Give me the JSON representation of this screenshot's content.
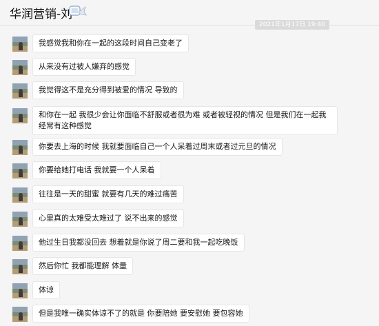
{
  "header": {
    "title": "华润营销-刘"
  },
  "time_badge": "2021年1月17日 19:40",
  "messages": [
    {
      "text": "我感觉我和你在一起的这段时间自己变老了"
    },
    {
      "text": "从来没有过被人嫌弃的感觉"
    },
    {
      "text": "我觉得这不是充分得到被爱的情况 导致的"
    },
    {
      "text": "和你在一起 我很少会让你面临不舒服或者很为难 或者被轻视的情况 但是我们在一起我经常有这种感觉"
    },
    {
      "text": "你要去上海的时候 我就要面临自己一个人呆着过周末或者过元旦的情况"
    },
    {
      "text": "你要给她打电话 我就要一个人呆着"
    },
    {
      "text": "往往是一天的甜蜜 就要有几天的难过痛苦"
    },
    {
      "text": "心里真的太难受太难过了 说不出来的感觉"
    },
    {
      "text": "他过生日我都没回去 想着就是你说了周二要和我一起吃晚饭"
    },
    {
      "text": "然后你忙 我都能理解 体量"
    },
    {
      "text": "体谅"
    },
    {
      "text": "但是我唯一确实体谅不了的就是 你要陪她 要安慰她 要包容她"
    }
  ]
}
